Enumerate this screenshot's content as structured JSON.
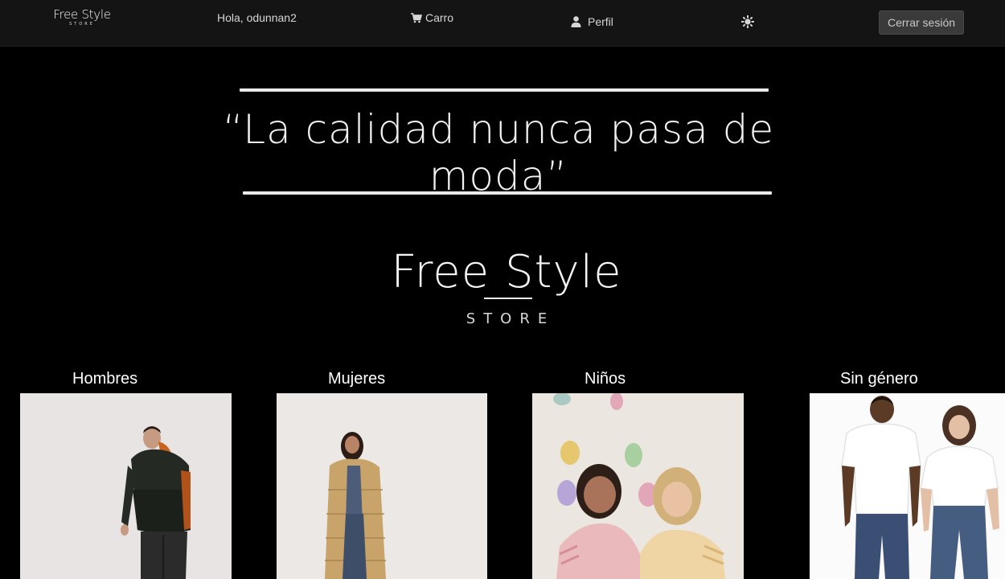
{
  "nav": {
    "logo_text": "Free Style",
    "logo_sub": "STORE",
    "greeting": "Hola, odunnan2",
    "cart_label": "Carro",
    "profile_label": "Perfil",
    "logout_label": "Cerrar sesión",
    "icons": [
      "cart-icon",
      "user-icon",
      "sun-icon"
    ]
  },
  "hero": {
    "quote": "“La calidad nunca pasa de moda”",
    "logo_text": "Free Style",
    "logo_sub": "STORE"
  },
  "categories": [
    {
      "title": "Hombres"
    },
    {
      "title": "Mujeres"
    },
    {
      "title": "Niños"
    },
    {
      "title": "Sin género"
    }
  ],
  "colors": {
    "navbar_bg": "#141414",
    "page_bg": "#000000",
    "button_bg": "#3a3a3a"
  }
}
